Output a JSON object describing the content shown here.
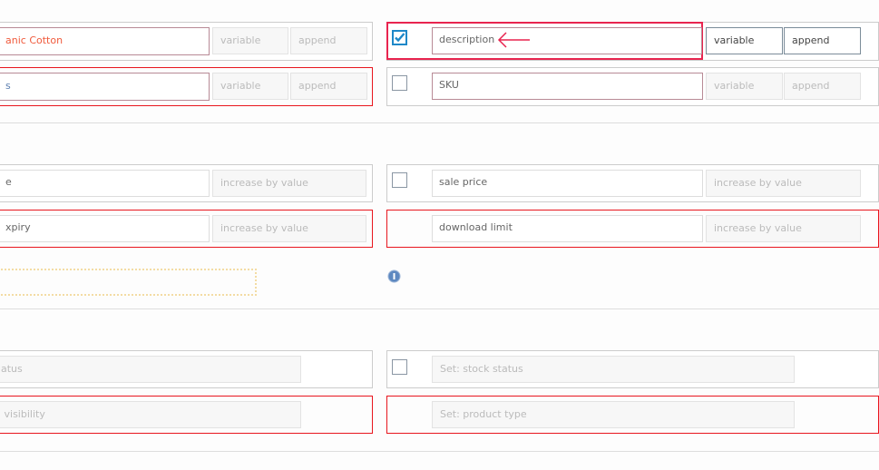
{
  "section1": {
    "left": [
      {
        "value": "anic Cotton",
        "mode": "variable",
        "action": "append"
      },
      {
        "value": "s",
        "mode": "variable",
        "action": "append"
      }
    ],
    "right": [
      {
        "checked": true,
        "value": "description",
        "mode": "variable",
        "action": "append"
      },
      {
        "checked": false,
        "value": "SKU",
        "mode": "variable",
        "action": "append"
      }
    ]
  },
  "section2": {
    "left": [
      {
        "value": "e",
        "operation": "increase by value"
      },
      {
        "value": "xpiry",
        "operation": "increase by value"
      }
    ],
    "right": [
      {
        "checked": false,
        "value": "sale price",
        "operation": "increase by value"
      },
      {
        "value": "download limit",
        "operation": "increase by value"
      }
    ]
  },
  "section3": {
    "left": [
      {
        "placeholder": "atus"
      },
      {
        "placeholder": " visibility"
      }
    ],
    "right": [
      {
        "checked": false,
        "placeholder": "Set: stock status"
      },
      {
        "placeholder": "Set: product type"
      }
    ]
  },
  "colors": {
    "highlight": "#e8244f",
    "error": "#e8161e",
    "checkbox_checked": "#1e88c8",
    "value_text": "#f05a3c"
  }
}
